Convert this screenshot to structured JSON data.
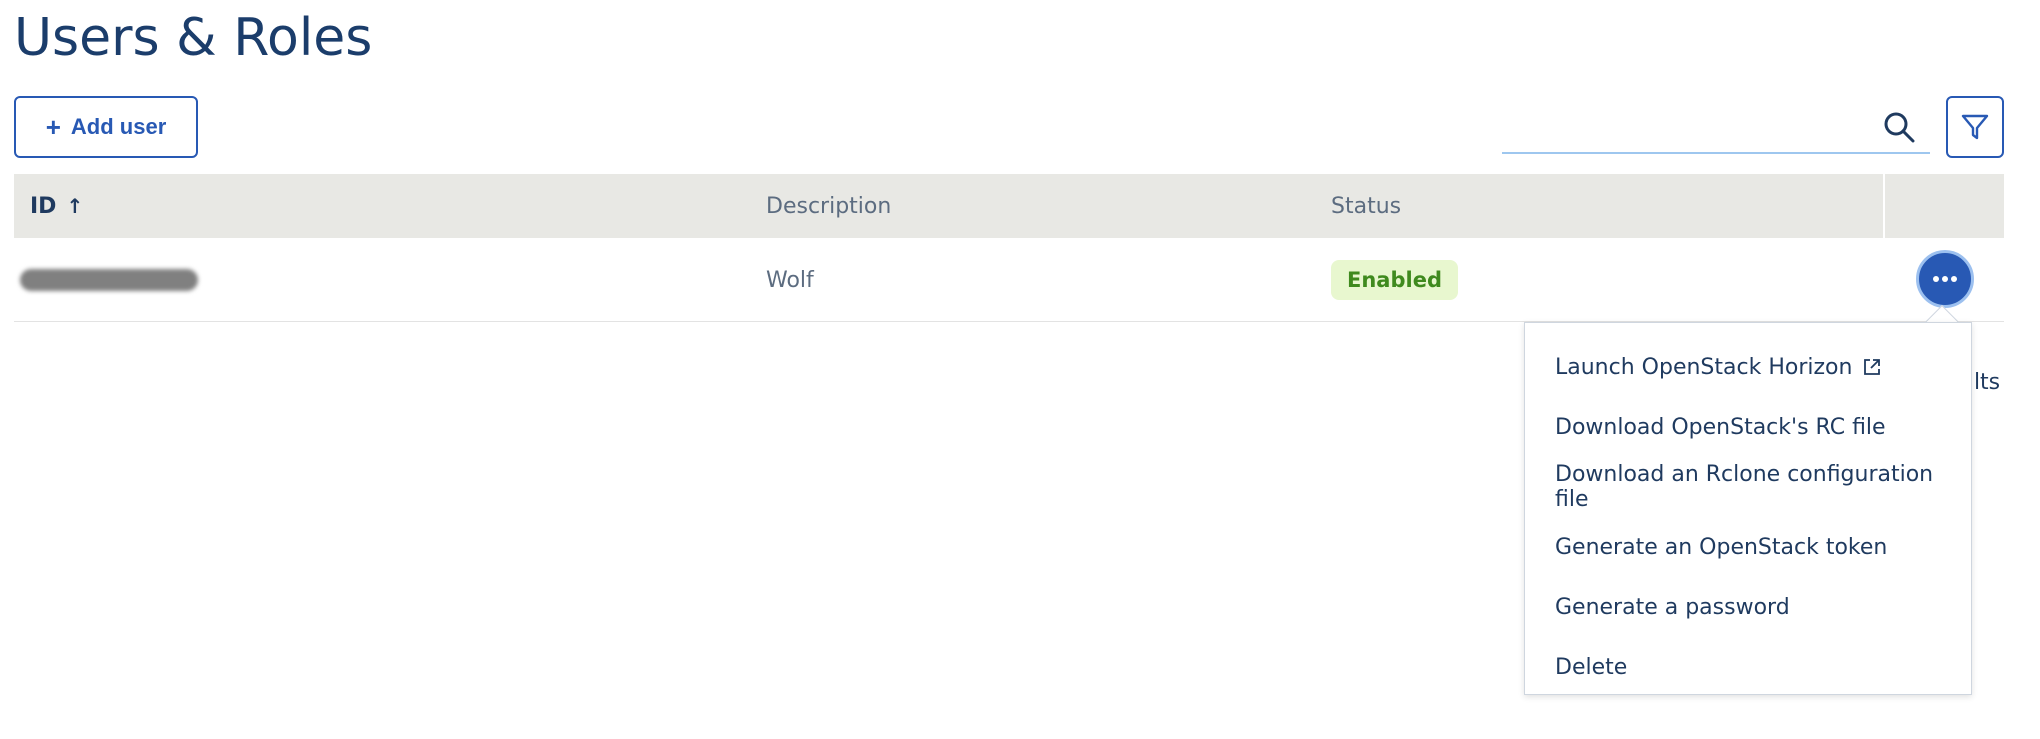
{
  "page": {
    "title": "Users & Roles"
  },
  "toolbar": {
    "add_user_label": "Add user",
    "search_placeholder": "",
    "search_value": ""
  },
  "table": {
    "columns": [
      {
        "label": "ID",
        "sorted": "ascending"
      },
      {
        "label": "Description"
      },
      {
        "label": "Status"
      }
    ],
    "rows": [
      {
        "id": "",
        "description": "Wolf",
        "status": "Enabled"
      }
    ]
  },
  "results_hint": "ults",
  "actions_menu": {
    "items": [
      {
        "label": "Launch OpenStack Horizon",
        "icon": "external-link-icon"
      },
      {
        "label": "Download OpenStack's RC file"
      },
      {
        "label": "Download an Rclone configuration file"
      },
      {
        "label": "Generate an OpenStack token"
      },
      {
        "label": "Generate a password"
      },
      {
        "label": "Delete"
      }
    ]
  },
  "colors": {
    "primary": "#2859b4",
    "title": "#1b3d6b",
    "header_bg": "#e8e8e4",
    "badge_bg": "#e8f7cf",
    "badge_text": "#3f8a1e",
    "search_underline": "#9ec7ef"
  }
}
